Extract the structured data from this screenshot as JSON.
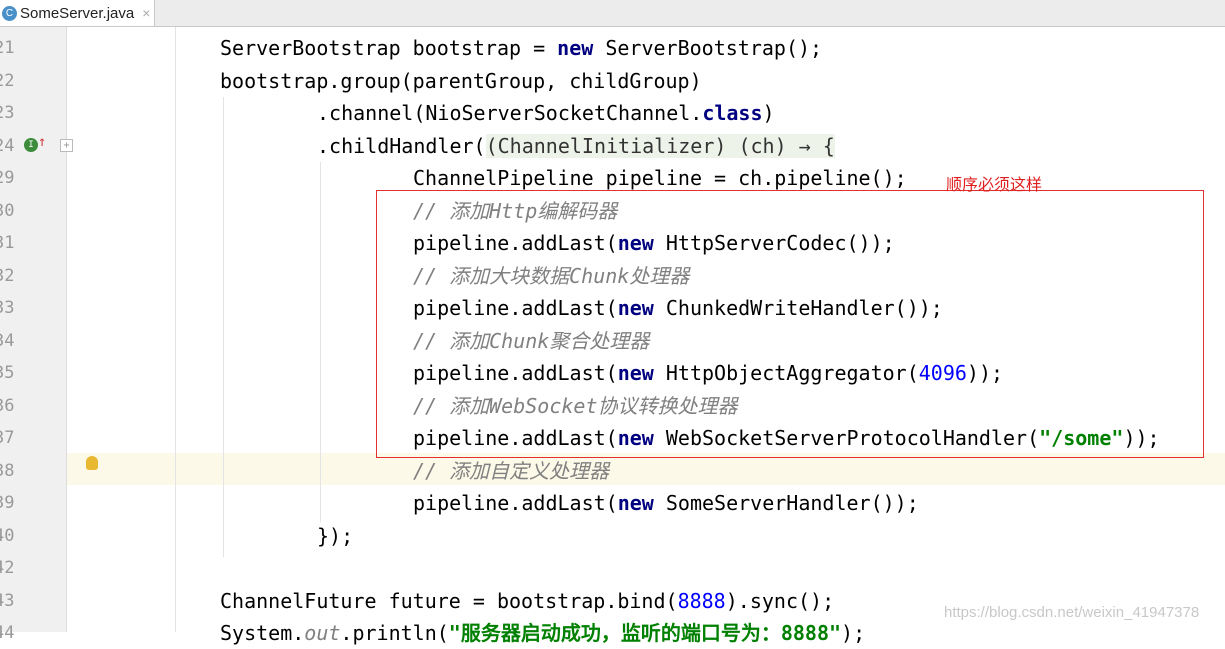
{
  "tab": {
    "title": "SomeServer.java",
    "icon": "java-class-icon",
    "close": "×"
  },
  "annotation": "顺序必须这样",
  "watermark": "https://blog.csdn.net/weixin_41947378",
  "lines": [
    {
      "n": "21",
      "indent": 1,
      "tokens": [
        [
          "",
          "ServerBootstrap bootstrap = "
        ],
        [
          "kw",
          "new"
        ],
        [
          "",
          " ServerBootstrap();"
        ]
      ]
    },
    {
      "n": "22",
      "indent": 1,
      "tokens": [
        [
          "",
          "bootstrap.group(parentGroup, childGroup)"
        ]
      ]
    },
    {
      "n": "23",
      "indent": 2,
      "tokens": [
        [
          "",
          ".channel(NioServerSocketChannel."
        ],
        [
          "kw",
          "class"
        ],
        [
          "",
          ")"
        ]
      ]
    },
    {
      "n": "24",
      "indent": 2,
      "tokens": [
        [
          "",
          ".childHandler("
        ],
        [
          "lam",
          "(ChannelInitializer) (ch) → {"
        ]
      ]
    },
    {
      "n": "29",
      "indent": 3,
      "tokens": [
        [
          "",
          "ChannelPipeline pipeline = ch.pipeline();"
        ]
      ]
    },
    {
      "n": "30",
      "indent": 3,
      "tokens": [
        [
          "cm",
          "// 添加Http编解码器"
        ]
      ]
    },
    {
      "n": "31",
      "indent": 3,
      "tokens": [
        [
          "",
          "pipeline.addLast("
        ],
        [
          "kw",
          "new"
        ],
        [
          "",
          " HttpServerCodec());"
        ]
      ]
    },
    {
      "n": "32",
      "indent": 3,
      "tokens": [
        [
          "cm",
          "// 添加大块数据Chunk处理器"
        ]
      ]
    },
    {
      "n": "33",
      "indent": 3,
      "tokens": [
        [
          "",
          "pipeline.addLast("
        ],
        [
          "kw",
          "new"
        ],
        [
          "",
          " ChunkedWriteHandler());"
        ]
      ]
    },
    {
      "n": "34",
      "indent": 3,
      "tokens": [
        [
          "cm",
          "// 添加Chunk聚合处理器"
        ]
      ]
    },
    {
      "n": "35",
      "indent": 3,
      "tokens": [
        [
          "",
          "pipeline.addLast("
        ],
        [
          "kw",
          "new"
        ],
        [
          "",
          " HttpObjectAggregator("
        ],
        [
          "num",
          "4096"
        ],
        [
          "",
          "));"
        ]
      ]
    },
    {
      "n": "36",
      "indent": 3,
      "tokens": [
        [
          "cm",
          "// 添加WebSocket协议转换处理器"
        ]
      ]
    },
    {
      "n": "37",
      "indent": 3,
      "tokens": [
        [
          "",
          "pipeline.addLast("
        ],
        [
          "kw",
          "new"
        ],
        [
          "",
          " WebSocketServerProtocolHandler("
        ],
        [
          "str",
          "\"/some\""
        ],
        [
          "",
          "));"
        ]
      ]
    },
    {
      "n": "38",
      "indent": 3,
      "tokens": [
        [
          "cm",
          "// 添加自定义处理器"
        ]
      ]
    },
    {
      "n": "39",
      "indent": 3,
      "tokens": [
        [
          "",
          "pipeline.addLast("
        ],
        [
          "kw",
          "new"
        ],
        [
          "",
          " SomeServerHandler());"
        ]
      ]
    },
    {
      "n": "40",
      "indent": 2,
      "tokens": [
        [
          "",
          "});"
        ]
      ]
    },
    {
      "n": "42",
      "indent": 1,
      "tokens": []
    },
    {
      "n": "43",
      "indent": 1,
      "tokens": [
        [
          "",
          "ChannelFuture future = bootstrap.bind("
        ],
        [
          "num",
          "8888"
        ],
        [
          "",
          ").sync();"
        ]
      ]
    },
    {
      "n": "44",
      "indent": 1,
      "tokens": [
        [
          "",
          "System."
        ],
        [
          "cm",
          "out"
        ],
        [
          "",
          ".println("
        ],
        [
          "str",
          "\"服务器启动成功，监听的端口号为：8888\""
        ],
        [
          "",
          ");"
        ]
      ]
    }
  ]
}
